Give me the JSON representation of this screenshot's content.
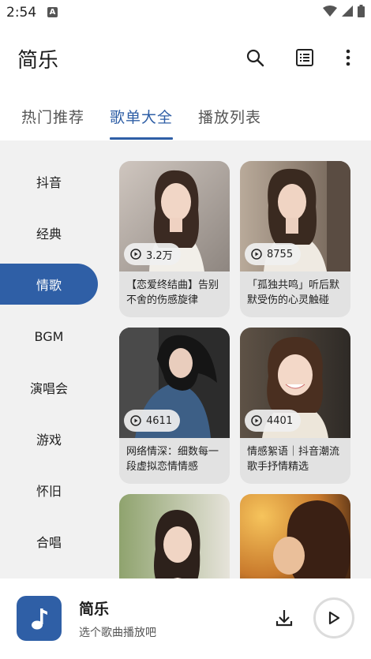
{
  "status_bar": {
    "time": "2:54",
    "notification_badge": "A"
  },
  "app_bar": {
    "title": "简乐"
  },
  "tabs": [
    {
      "label": "热门推荐",
      "active": false
    },
    {
      "label": "歌单大全",
      "active": true
    },
    {
      "label": "播放列表",
      "active": false
    }
  ],
  "sidebar": {
    "items": [
      {
        "label": "抖音",
        "active": false
      },
      {
        "label": "经典",
        "active": false
      },
      {
        "label": "情歌",
        "active": true
      },
      {
        "label": "BGM",
        "active": false
      },
      {
        "label": "演唱会",
        "active": false
      },
      {
        "label": "游戏",
        "active": false
      },
      {
        "label": "怀旧",
        "active": false
      },
      {
        "label": "合唱",
        "active": false
      }
    ]
  },
  "playlists": [
    {
      "count": "3.2万",
      "line1": "【恋爱终结曲】告别",
      "line2": "不舍的伤感旋律"
    },
    {
      "count": "8755",
      "line1": "「孤独共鸣」听后默",
      "line2": "默受伤的心灵触碰"
    },
    {
      "count": "4611",
      "line1": "网络情深：细数每一",
      "line2": "段虚拟恋情情感"
    },
    {
      "count": "4401",
      "line1": "情感絮语｜抖音潮流",
      "line2": "歌手抒情精选"
    },
    {
      "count": "",
      "line1": "",
      "line2": ""
    },
    {
      "count": "",
      "line1": "",
      "line2": ""
    }
  ],
  "player": {
    "title": "简乐",
    "subtitle": "选个歌曲播放吧"
  },
  "colors": {
    "accent": "#2f5fa6",
    "panel": "#f1f1f1",
    "card": "#e2e2e2"
  }
}
